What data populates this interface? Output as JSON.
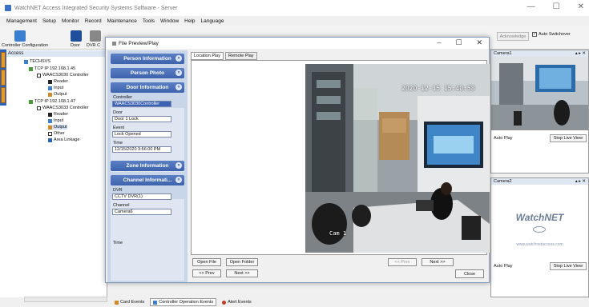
{
  "app": {
    "title": "WatchNET Access Integrated Security Systems Software - Server",
    "controls": [
      "—",
      "☐",
      "✕"
    ]
  },
  "menu": [
    "Management",
    "Setup",
    "Monitor",
    "Record",
    "Maintenance",
    "Tools",
    "Window",
    "Help",
    "Language"
  ],
  "toolbar": {
    "labels": [
      "Controller Configuration",
      "Door",
      "DVR C"
    ],
    "acknowledge": "Acknowledge",
    "auto_switchover": "Auto Switchover"
  },
  "tree": {
    "header": "Access",
    "items": [
      "TECHSVS",
      "TCP IP 192.168.1.45",
      "WAACS3030 Controller",
      "Reader",
      "Input",
      "Output",
      "TCP IP 192.168.1.47",
      "WAACS3033 Controller",
      "Reader",
      "Input",
      "Output",
      "Other",
      "Area Linkage"
    ]
  },
  "dialog": {
    "title": "File Preview/Play",
    "sections": {
      "person_info": "Person Information",
      "person_photo": "Person Photo",
      "door_info": "Door Information",
      "zone_info": "Zone Information",
      "channel_info": "Channel Informati..."
    },
    "door": {
      "controller_label": "Controller",
      "controller_value": "WAACS3030Controller",
      "door_label": "Door",
      "door_value": "Door 1 Lock",
      "event_label": "Event",
      "event_value": "Lock Opened",
      "time_label": "Time",
      "time_value": "12/15/2020 3:56:00 PM"
    },
    "channel": {
      "dvr_label": "DVR",
      "dvr_value": "CCTV DVR(1)",
      "channel_label": "Channel",
      "channel_value": "Camera6",
      "time_label": "Time"
    },
    "tabs": [
      "Location Play",
      "Remote Play"
    ],
    "video": {
      "timestamp": "2020-12-15 15:40:58",
      "camera_label": "Cam 1"
    },
    "buttons": {
      "open_file": "Open File",
      "open_folder": "Open Folder",
      "prev": "<< Prev",
      "next": "Next >>",
      "prev2": "<< Prev",
      "next2": "Next >>",
      "close": "Close"
    }
  },
  "cameras": [
    {
      "title": "Camera1",
      "label": "Auto Play",
      "button": "Stop Live View"
    },
    {
      "title": "Camera2",
      "label": "Auto Play",
      "button": "Stop Live View",
      "brand": "WatchNET",
      "url": "www.watchnetaccess.com"
    }
  ],
  "bottom_tabs": [
    "Card Events",
    "Controller Operation Events",
    "Alert Events"
  ],
  "colors": {
    "accent": "#3d63ad",
    "panel": "#c9d6ea",
    "orange": "#e69a2e"
  }
}
